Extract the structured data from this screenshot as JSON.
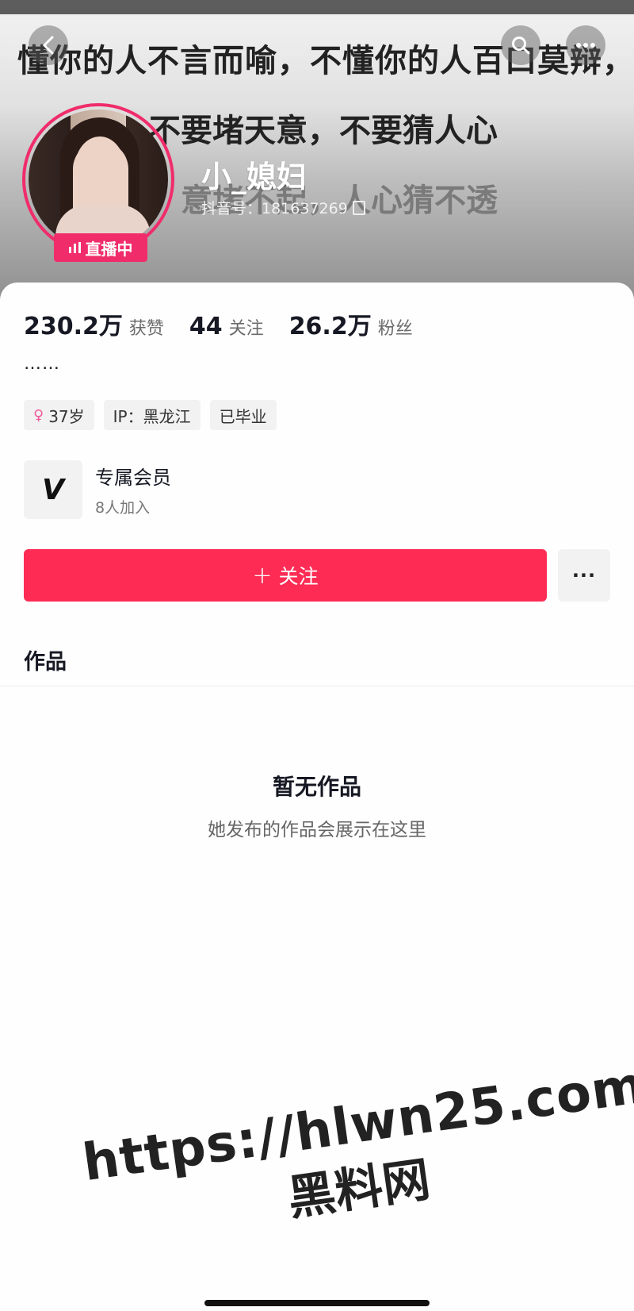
{
  "header": {
    "bg_text_line1": "懂你的人不言而喻，不懂你的人百口莫辩，",
    "bg_text_line2": "不要堵天意，不要猜人心",
    "bg_text_line3": "意堵不起，人心猜不透",
    "live_label": "直播中",
    "username": "小_媳妇",
    "douyin_id": "抖音号：181637269",
    "back_icon": "chevron-left-icon",
    "search_icon": "search-icon",
    "more_icon": "more-icon"
  },
  "stats": [
    {
      "value": "230.2万",
      "label": "获赞"
    },
    {
      "value": "44",
      "label": "关注"
    },
    {
      "value": "26.2万",
      "label": "粉丝"
    }
  ],
  "bio": "……",
  "tags": {
    "age": "37岁",
    "ip": "IP：黑龙江",
    "status": "已毕业"
  },
  "member": {
    "title": "专属会员",
    "subtitle": "8人加入",
    "icon_glyph": "V"
  },
  "actions": {
    "follow_label": "关注",
    "follow_plus": "+",
    "more_label": "···"
  },
  "tabs": {
    "works": "作品"
  },
  "empty_state": {
    "title": "暂无作品",
    "subtitle": "她发布的作品会展示在这里"
  },
  "watermark": {
    "url": "https://hlwn25.com",
    "text": "黑料网"
  },
  "colors": {
    "accent": "#fe2c55",
    "live": "#f02c6b"
  }
}
